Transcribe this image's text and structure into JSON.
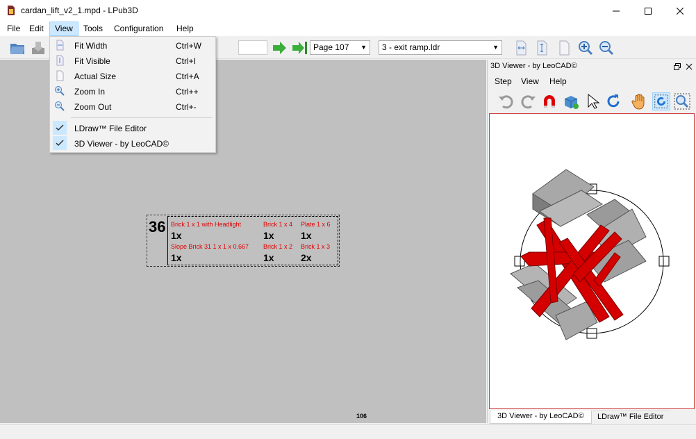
{
  "window": {
    "title": "cardan_lift_v2_1.mpd - LPub3D"
  },
  "menubar": [
    "File",
    "Edit",
    "View",
    "Tools",
    "Configuration",
    "Help"
  ],
  "view_menu": [
    {
      "label": "Fit Width",
      "shortcut": "Ctrl+W",
      "icon": "fit-width-icon"
    },
    {
      "label": "Fit Visible",
      "shortcut": "Ctrl+I",
      "icon": "fit-visible-icon"
    },
    {
      "label": "Actual Size",
      "shortcut": "Ctrl+A",
      "icon": "actual-size-icon"
    },
    {
      "label": "Zoom In",
      "shortcut": "Ctrl++",
      "icon": "zoom-in-icon"
    },
    {
      "label": "Zoom Out",
      "shortcut": "Ctrl+-",
      "icon": "zoom-out-icon"
    },
    {
      "label": "LDraw™ File Editor",
      "checked": true
    },
    {
      "label": "3D Viewer - by LeoCAD©",
      "checked": true
    }
  ],
  "toolbar": {
    "page_combo": "Page 107",
    "submodel_combo": "3 - exit ramp.ldr",
    "page_input": ""
  },
  "page": {
    "step_number": "36",
    "page_number": "106",
    "parts": [
      {
        "name": "Brick 1 x 1 with Headlight",
        "qty": "1x"
      },
      {
        "name": "Brick 1 x 4",
        "qty": "1x"
      },
      {
        "name": "Plate 1 x 6",
        "qty": "1x"
      },
      {
        "name": "Slope Brick 31 1 x 1 x 0.667",
        "qty": "1x"
      },
      {
        "name": "Brick 1 x 2",
        "qty": "1x"
      },
      {
        "name": "Brick 1 x 3",
        "qty": "2x"
      }
    ]
  },
  "viewer": {
    "title": "3D Viewer - by LeoCAD©",
    "menu": [
      "Step",
      "View",
      "Help"
    ],
    "tabs": [
      "3D Viewer - by LeoCAD©",
      "LDraw™ File Editor"
    ]
  },
  "colors": {
    "accent": "#cce8ff",
    "part_label": "#e00000",
    "lego_red": "#d40000",
    "lego_gray": "#a0a0a0"
  }
}
